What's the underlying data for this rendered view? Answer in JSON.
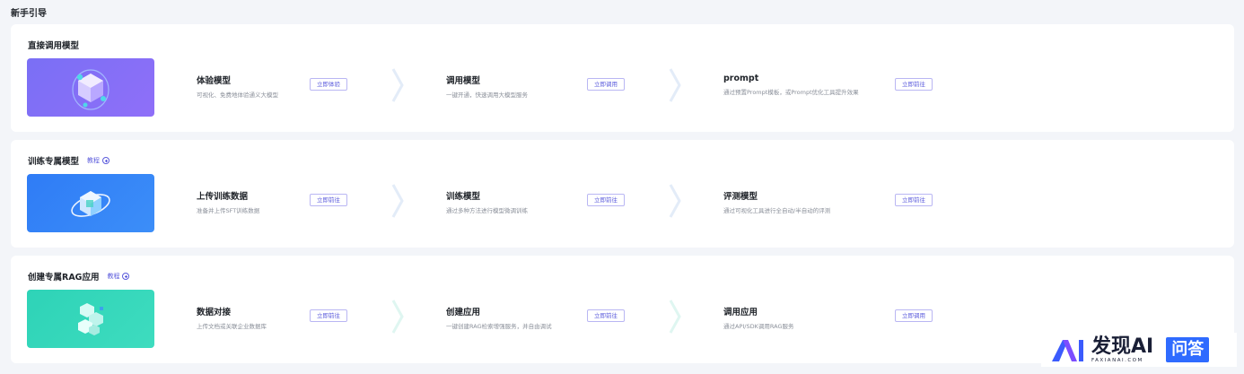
{
  "page_title": "新手引导",
  "sections": [
    {
      "title": "直接调用模型",
      "tutorial": "",
      "steps": [
        {
          "title": "体验模型",
          "desc": "可视化、免费地体验通义大模型",
          "button": "立即体验"
        },
        {
          "title": "调用模型",
          "desc": "一键开通，快速调用大模型服务",
          "button": "立即调用"
        },
        {
          "title": "prompt",
          "desc": "通过预置Prompt模板，或Prompt优化工具提升效果",
          "button": "立即前往"
        }
      ]
    },
    {
      "title": "训练专属模型",
      "tutorial": "教程",
      "steps": [
        {
          "title": "上传训练数据",
          "desc": "准备并上传SFT训练数据",
          "button": "立即前往"
        },
        {
          "title": "训练模型",
          "desc": "通过多种方法进行模型微调训练",
          "button": "立即前往"
        },
        {
          "title": "评测模型",
          "desc": "通过可视化工具进行全自动/半自动的评测",
          "button": "立即前往"
        }
      ]
    },
    {
      "title": "创建专属RAG应用",
      "tutorial": "教程",
      "steps": [
        {
          "title": "数据对接",
          "desc": "上传文档或关联企业数据库",
          "button": "立即前往"
        },
        {
          "title": "创建应用",
          "desc": "一键创建RAG检索增强服务，并自由调试",
          "button": "立即前往"
        },
        {
          "title": "调用应用",
          "desc": "通过API/SDK调用RAG服务",
          "button": "立即调用"
        }
      ]
    }
  ],
  "watermark": {
    "main": "发现AI",
    "sub": "FAXIANAI.COM",
    "badge": "问答"
  },
  "colors": {
    "accent": "#5b5bdc",
    "banner_purple": "#7a6ff5",
    "banner_blue": "#2f7cf6",
    "banner_teal": "#2ed3b7"
  }
}
